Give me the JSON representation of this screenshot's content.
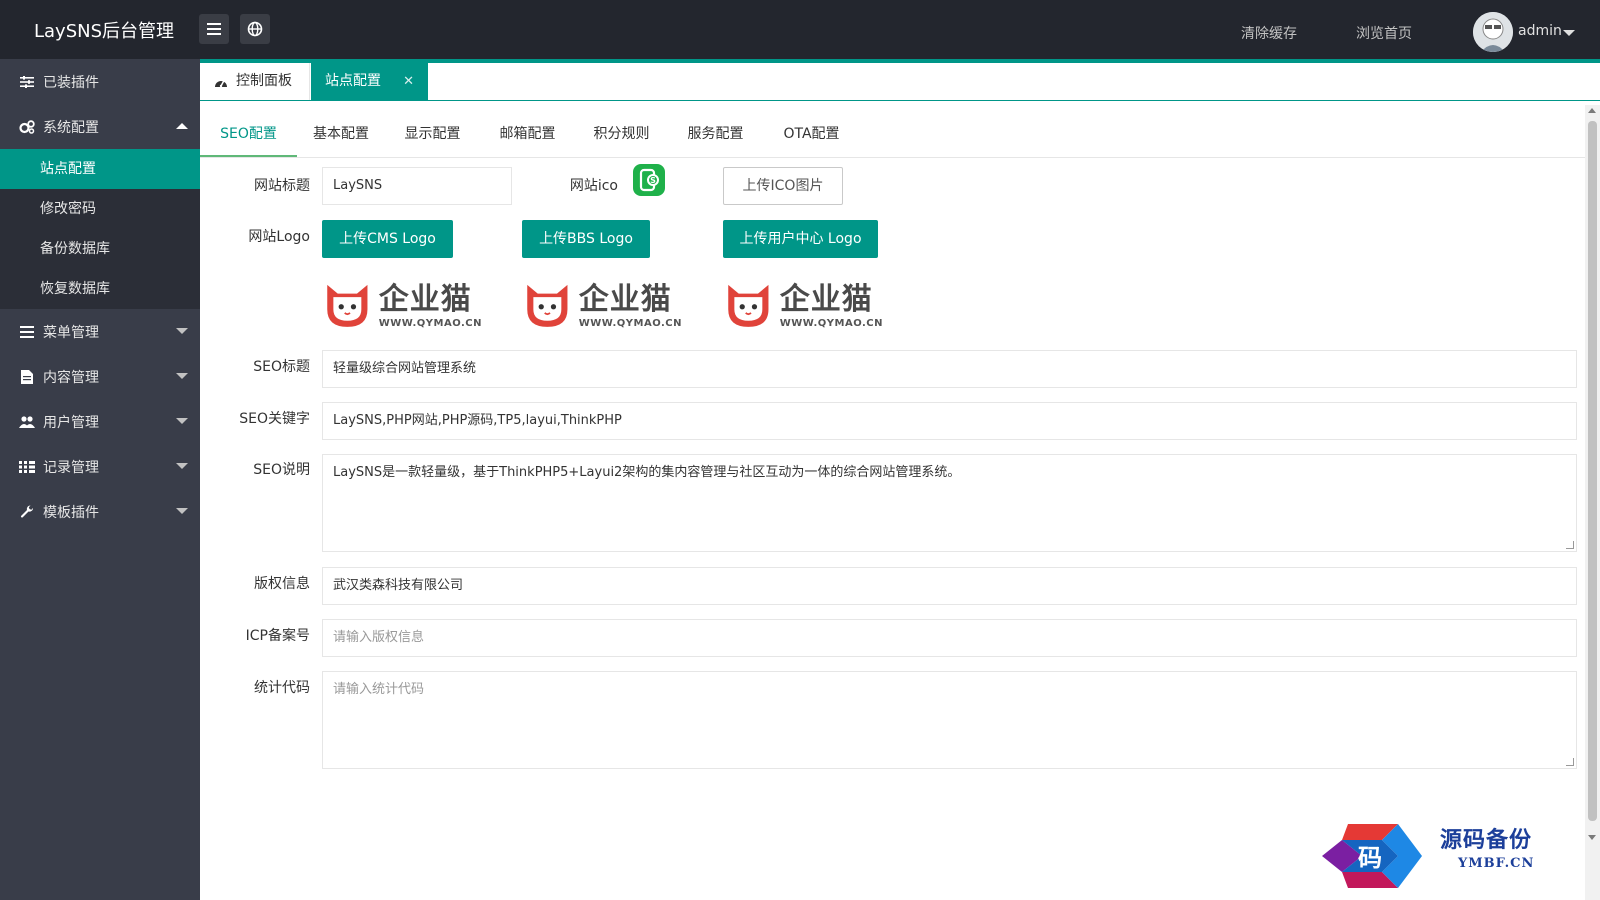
{
  "header": {
    "brand": "LaySNS后台管理",
    "clear_cache": "清除缓存",
    "browse_home": "浏览首页",
    "username": "admin"
  },
  "sidebar": {
    "items": [
      {
        "label": "已装插件",
        "icon": "sliders-icon"
      },
      {
        "label": "系统配置",
        "icon": "cogs-icon",
        "expanded": true
      },
      {
        "label": "菜单管理",
        "icon": "list-icon"
      },
      {
        "label": "内容管理",
        "icon": "file-icon"
      },
      {
        "label": "用户管理",
        "icon": "users-icon"
      },
      {
        "label": "记录管理",
        "icon": "grid-list-icon"
      },
      {
        "label": "模板插件",
        "icon": "wrench-icon"
      }
    ],
    "sub_items": [
      {
        "label": "站点配置",
        "active": true
      },
      {
        "label": "修改密码"
      },
      {
        "label": "备份数据库"
      },
      {
        "label": "恢复数据库"
      }
    ]
  },
  "top_tabs": [
    {
      "label": "控制面板",
      "icon": "dashboard-icon"
    },
    {
      "label": "站点配置",
      "active": true,
      "close": "✕"
    }
  ],
  "config_tabs": [
    "SEO配置",
    "基本配置",
    "显示配置",
    "邮箱配置",
    "积分规则",
    "服务配置",
    "OTA配置"
  ],
  "form": {
    "site_title_label": "网站标题",
    "site_title_value": "LaySNS",
    "site_ico_label": "网站ico",
    "upload_ico": "上传ICO图片",
    "site_logo_label": "网站Logo",
    "upload_cms_logo": "上传CMS Logo",
    "upload_bbs_logo": "上传BBS Logo",
    "upload_user_logo": "上传用户中心 Logo",
    "logo_text": "企业猫",
    "logo_url": "WWW.QYMAO.CN",
    "seo_title_label": "SEO标题",
    "seo_title_value": "轻量级综合网站管理系统",
    "seo_keywords_label": "SEO关键字",
    "seo_keywords_value": "LaySNS,PHP网站,PHP源码,TP5,layui,ThinkPHP",
    "seo_desc_label": "SEO说明",
    "seo_desc_value": "LaySNS是一款轻量级，基于ThinkPHP5+Layui2架构的集内容管理与社区互动为一体的综合网站管理系统。",
    "copyright_label": "版权信息",
    "copyright_value": "武汉类森科技有限公司",
    "icp_label": "ICP备案号",
    "icp_placeholder": "请输入版权信息",
    "stats_label": "统计代码",
    "stats_placeholder": "请输入统计代码"
  },
  "watermark": {
    "badge_char": "码",
    "name": "源码备份",
    "url": "YMBF.CN"
  },
  "colors": {
    "accent": "#009688",
    "header_bg": "#23262e",
    "sidebar_bg": "#393d49",
    "sidebar_sub_bg": "#2b2e37"
  }
}
